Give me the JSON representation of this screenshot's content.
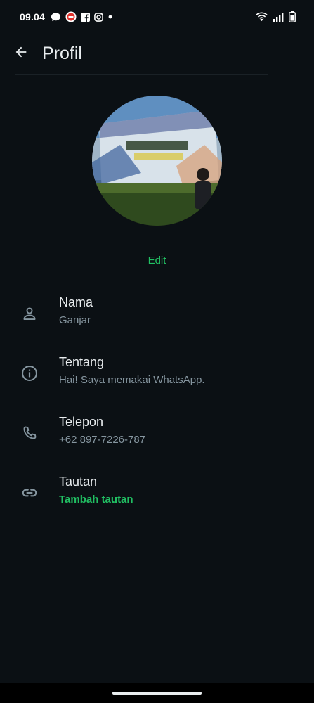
{
  "status_bar": {
    "time": "09.04",
    "left_icons": [
      "chat-bubble-icon",
      "notification-badge-icon",
      "facebook-icon",
      "instagram-icon",
      "dot-icon"
    ],
    "right_icons": [
      "wifi-icon",
      "signal-icon",
      "battery-icon"
    ]
  },
  "header": {
    "title": "Profil",
    "back_icon": "arrow-left-icon"
  },
  "profile": {
    "edit_label": "Edit"
  },
  "fields": [
    {
      "label": "Nama",
      "value": "Ganjar",
      "icon": "person-icon"
    },
    {
      "label": "Tentang",
      "value": "Hai! Saya memakai WhatsApp.",
      "icon": "info-icon"
    },
    {
      "label": "Telepon",
      "value": "+62 897-7226-787",
      "icon": "phone-icon"
    },
    {
      "label": "Tautan",
      "value": "Tambah tautan",
      "icon": "link-icon"
    }
  ],
  "colors": {
    "background": "#0b1014",
    "accent": "#21c063",
    "primary_text": "#e9edef",
    "secondary_text": "#8696a0",
    "icon": "#8696a0"
  }
}
